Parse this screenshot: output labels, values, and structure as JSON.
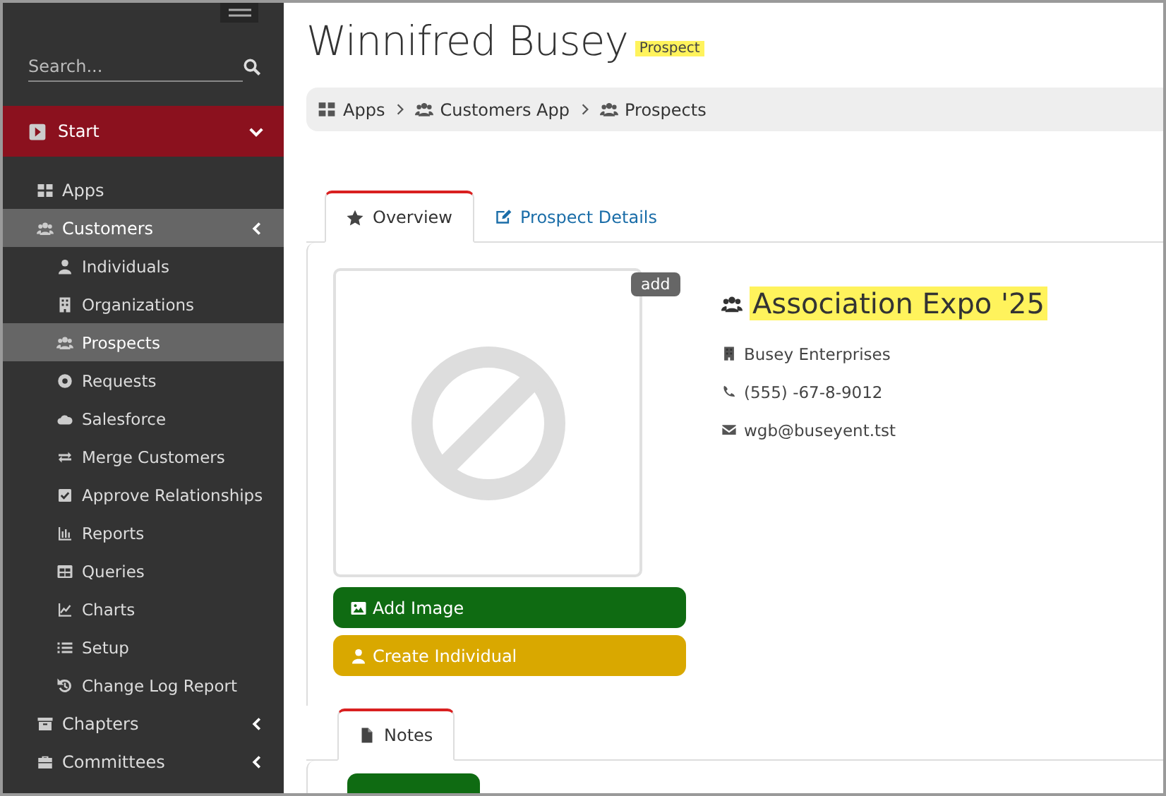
{
  "sidebar": {
    "search": {
      "placeholder": "Search..."
    },
    "section": {
      "label": "Start",
      "expanded": true
    },
    "items": [
      {
        "label": "Apps",
        "selected": false
      },
      {
        "label": "Customers",
        "selected": true,
        "expandable": true,
        "children": [
          {
            "label": "Individuals",
            "selected": false
          },
          {
            "label": "Organizations",
            "selected": false
          },
          {
            "label": "Prospects",
            "selected": true
          },
          {
            "label": "Requests",
            "selected": false
          },
          {
            "label": "Salesforce",
            "selected": false
          },
          {
            "label": "Merge Customers",
            "selected": false
          },
          {
            "label": "Approve Relationships",
            "selected": false
          },
          {
            "label": "Reports",
            "selected": false
          },
          {
            "label": "Queries",
            "selected": false
          },
          {
            "label": "Charts",
            "selected": false
          },
          {
            "label": "Setup",
            "selected": false
          },
          {
            "label": "Change Log Report",
            "selected": false
          }
        ]
      },
      {
        "label": "Chapters",
        "selected": false,
        "expandable": true
      },
      {
        "label": "Committees",
        "selected": false,
        "expandable": true
      }
    ]
  },
  "page": {
    "title": "Winnifred Busey",
    "badge": "Prospect"
  },
  "breadcrumb": [
    "Apps",
    "Customers App",
    "Prospects"
  ],
  "tabs": [
    {
      "label": "Overview",
      "selected": true
    },
    {
      "label": "Prospect Details",
      "selected": false
    }
  ],
  "profile": {
    "image_badge": "add",
    "buttons": [
      {
        "label": "Add Image",
        "kind": "success"
      },
      {
        "label": "Create Individual",
        "kind": "warning"
      }
    ],
    "heading": "Association Expo '25",
    "details": [
      "Busey Enterprises",
      "(555) -67-8-9012",
      "wgb@buseyent.tst"
    ]
  },
  "notes_tabs": [
    {
      "label": "Notes",
      "selected": true
    }
  ]
}
